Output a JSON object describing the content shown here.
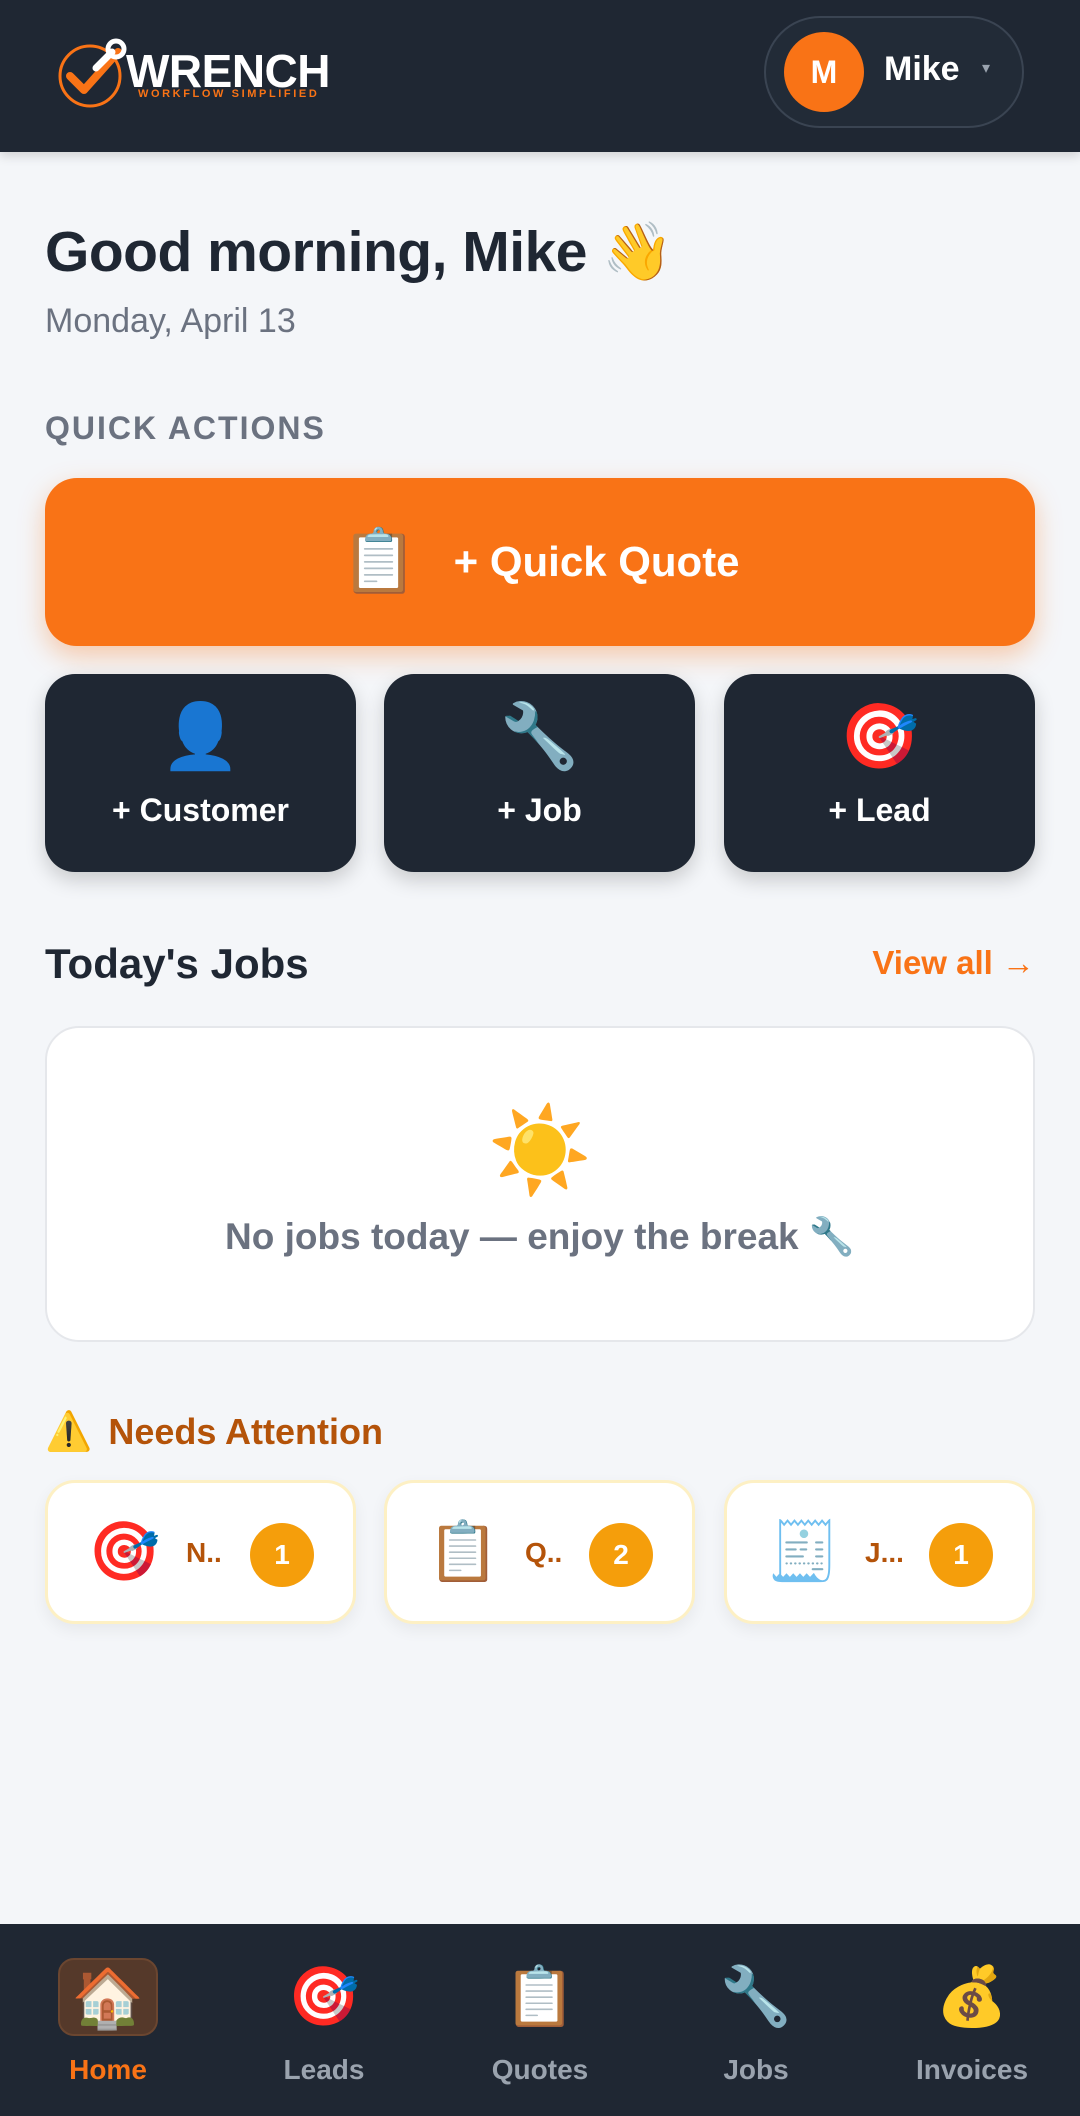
{
  "brand": {
    "name": "WRENCH",
    "tagline": "WORKFLOW SIMPLIFIED",
    "accent": "#f97316",
    "dark": "#1f2733"
  },
  "user": {
    "initial": "M",
    "name": "Mike",
    "caret": "▾"
  },
  "greeting": {
    "title": "Good morning, Mike 👋",
    "date": "Monday, April 13"
  },
  "quick_actions": {
    "section_label": "QUICK ACTIONS",
    "primary": {
      "icon": "📋",
      "label": "+ Quick Quote"
    },
    "tiles": [
      {
        "icon": "👤",
        "label": "+ Customer"
      },
      {
        "icon": "🔧",
        "label": "+ Job"
      },
      {
        "icon": "🎯",
        "label": "+ Lead"
      }
    ]
  },
  "todays_jobs": {
    "title": "Today's Jobs",
    "view_all": "View all →",
    "empty_icon": "☀️",
    "empty_text": "No jobs today — enjoy the break 🔧"
  },
  "attention": {
    "icon": "⚠️",
    "title": "Needs Attention",
    "items": [
      {
        "icon": "🎯",
        "label": "N..",
        "count": "1"
      },
      {
        "icon": "📋",
        "label": "Q..",
        "count": "2"
      },
      {
        "icon": "🧾",
        "label": "J...",
        "count": "1"
      }
    ]
  },
  "nav": {
    "items": [
      {
        "icon": "🏠",
        "label": "Home",
        "active": true
      },
      {
        "icon": "🎯",
        "label": "Leads",
        "active": false
      },
      {
        "icon": "📋",
        "label": "Quotes",
        "active": false
      },
      {
        "icon": "🔧",
        "label": "Jobs",
        "active": false
      },
      {
        "icon": "💰",
        "label": "Invoices",
        "active": false
      }
    ]
  }
}
